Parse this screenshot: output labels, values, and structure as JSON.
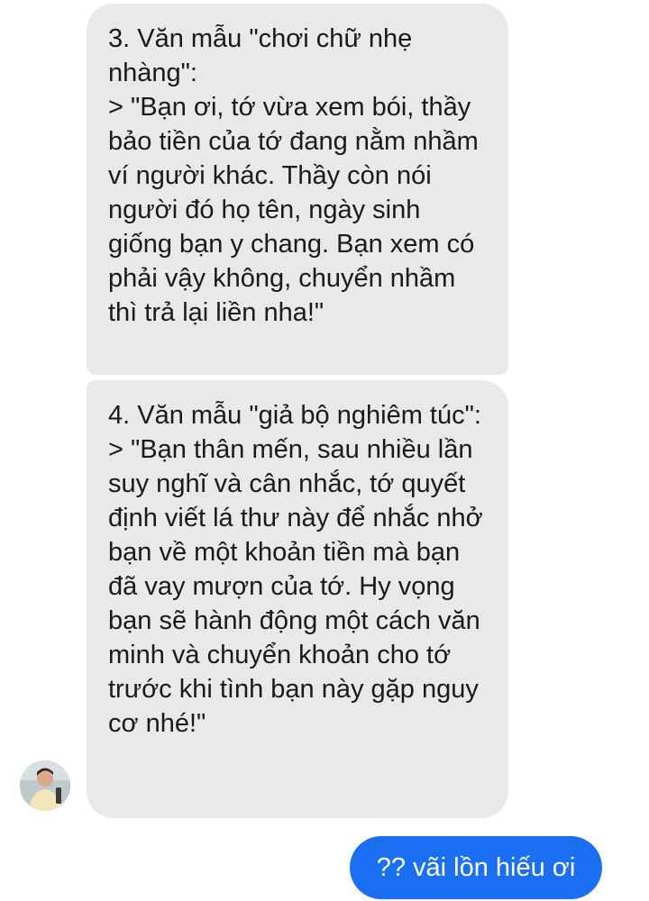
{
  "conversation": {
    "messages": [
      {
        "direction": "incoming",
        "text": "3. Văn mẫu \"chơi chữ nhẹ nhàng\":\n> \"Bạn ơi, tớ vừa xem bói, thầy bảo tiền của tớ đang nằm nhầm ví người khác. Thầy còn nói người đó họ tên, ngày sinh giống bạn y chang. Bạn xem có phải vậy không, chuyển nhầm thì trả lại liền nha!\""
      },
      {
        "direction": "incoming",
        "text": "4. Văn mẫu \"giả bộ nghiêm túc\":\n> \"Bạn thân mến, sau nhiều lần suy nghĩ và cân nhắc, tớ quyết định viết lá thư này để nhắc nhở bạn về một khoản tiền mà bạn đã vay mượn của tớ. Hy vọng bạn sẽ hành động một cách văn minh và chuyển khoản cho tớ trước khi tình bạn này gặp nguy cơ nhé!\""
      },
      {
        "direction": "outgoing",
        "text": "?? vãi lồn hiếu ơi"
      }
    ],
    "sender_avatar_icon": "user-avatar-photo"
  },
  "colors": {
    "incoming_bubble": "#e9e9eb",
    "outgoing_bubble": "#1a6ff2",
    "background": "#ffffff"
  }
}
